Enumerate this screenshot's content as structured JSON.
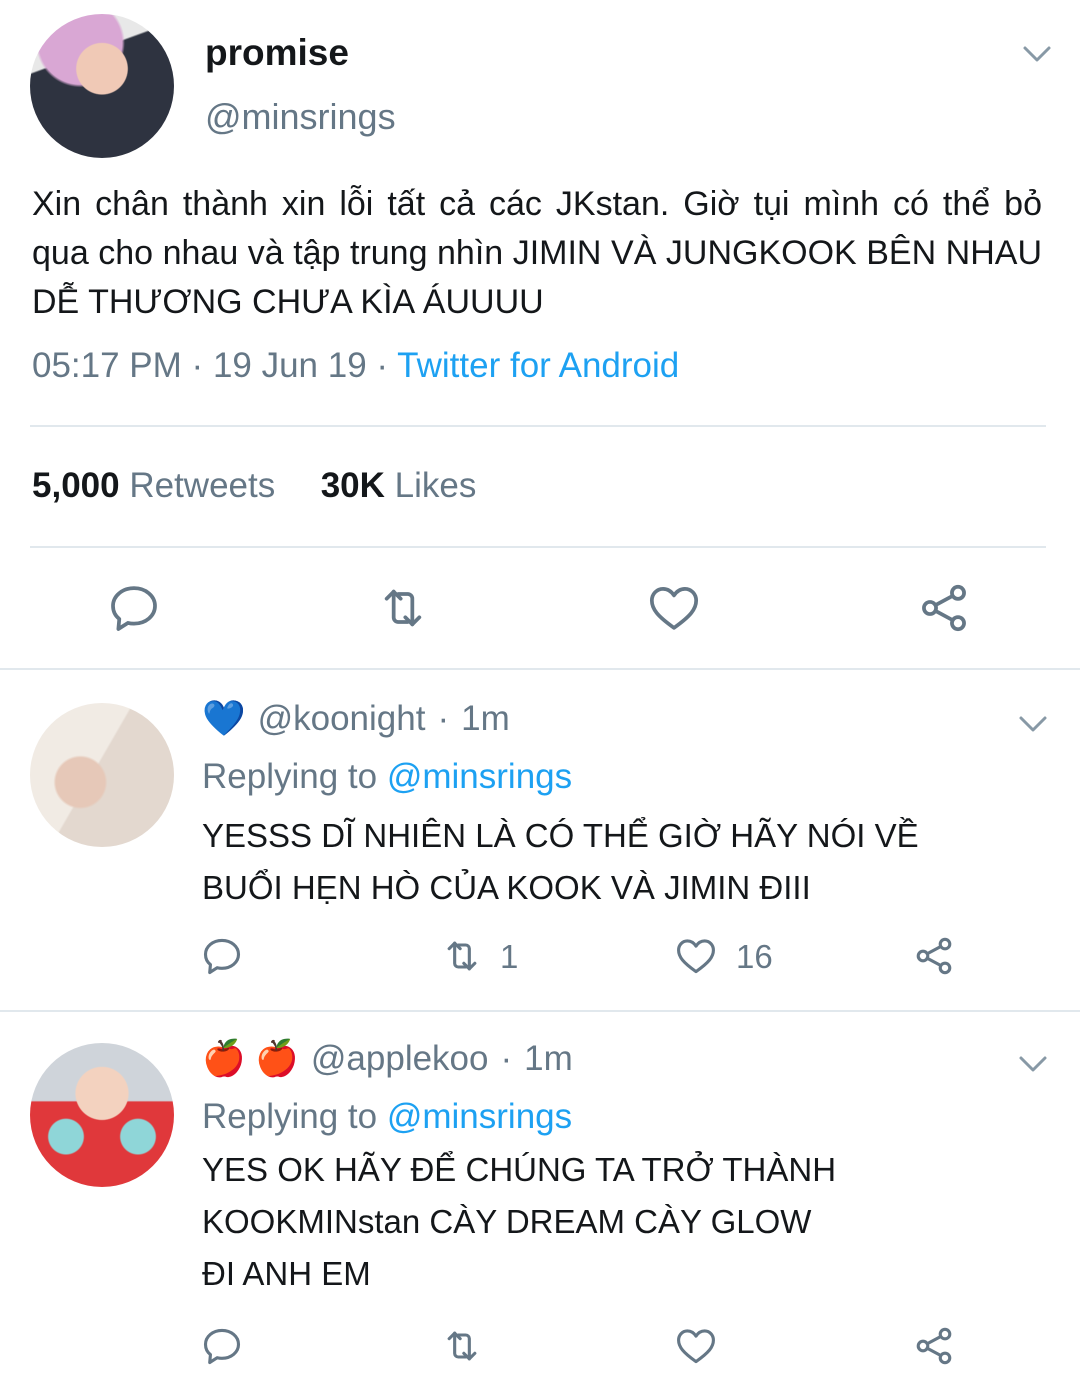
{
  "tweet": {
    "name": "promise",
    "handle": "@minsrings",
    "text_lines": [
      "Xin chân thành xin lỗi tất cả các JKstan. Giờ tụi mình có thể bỏ qua cho nhau và tập trung nhìn JIMIN VÀ JUNGKOOK BÊN NHAU DỄ THƯƠNG CHƯA KÌA ÁUUUU"
    ],
    "time": "05:17 PM",
    "date": "19 Jun 19",
    "sep": "·",
    "source": "Twitter for Android",
    "retweets_count": "5,000",
    "retweets_label": "Retweets",
    "likes_count": "30K",
    "likes_label": "Likes"
  },
  "replies": [
    {
      "emoji": "💙",
      "handle": "@koonight",
      "sep": "·",
      "age": "1m",
      "replying_label": "Replying to",
      "replying_to": "@minsrings",
      "lines": [
        "YESSS DĨ NHIÊN LÀ CÓ THỂ GIỜ HÃY NÓI VỀ",
        "BUỔI HẸN HÒ CỦA KOOK VÀ JIMIN ĐIII"
      ],
      "retweets": "1",
      "likes": "16"
    },
    {
      "emoji": "🍎 🍎",
      "handle": "@applekoo",
      "sep": "·",
      "age": "1m",
      "replying_label": "Replying to",
      "replying_to": "@minsrings",
      "lines": [
        "YES OK HÃY ĐỂ CHÚNG TA TRỞ THÀNH",
        "KOOKMINstan CÀY DREAM CÀY GLOW",
        "ĐI ANH EM"
      ],
      "retweets": "",
      "likes": ""
    }
  ],
  "icons": {
    "reply": "reply-icon",
    "retweet": "retweet-icon",
    "like": "heart-icon",
    "share": "share-icon",
    "menu": "chevron-down-icon"
  },
  "colors": {
    "accent": "#1da1f2",
    "muted": "#657786",
    "text": "#14171a",
    "divider": "#e1e8ed"
  }
}
